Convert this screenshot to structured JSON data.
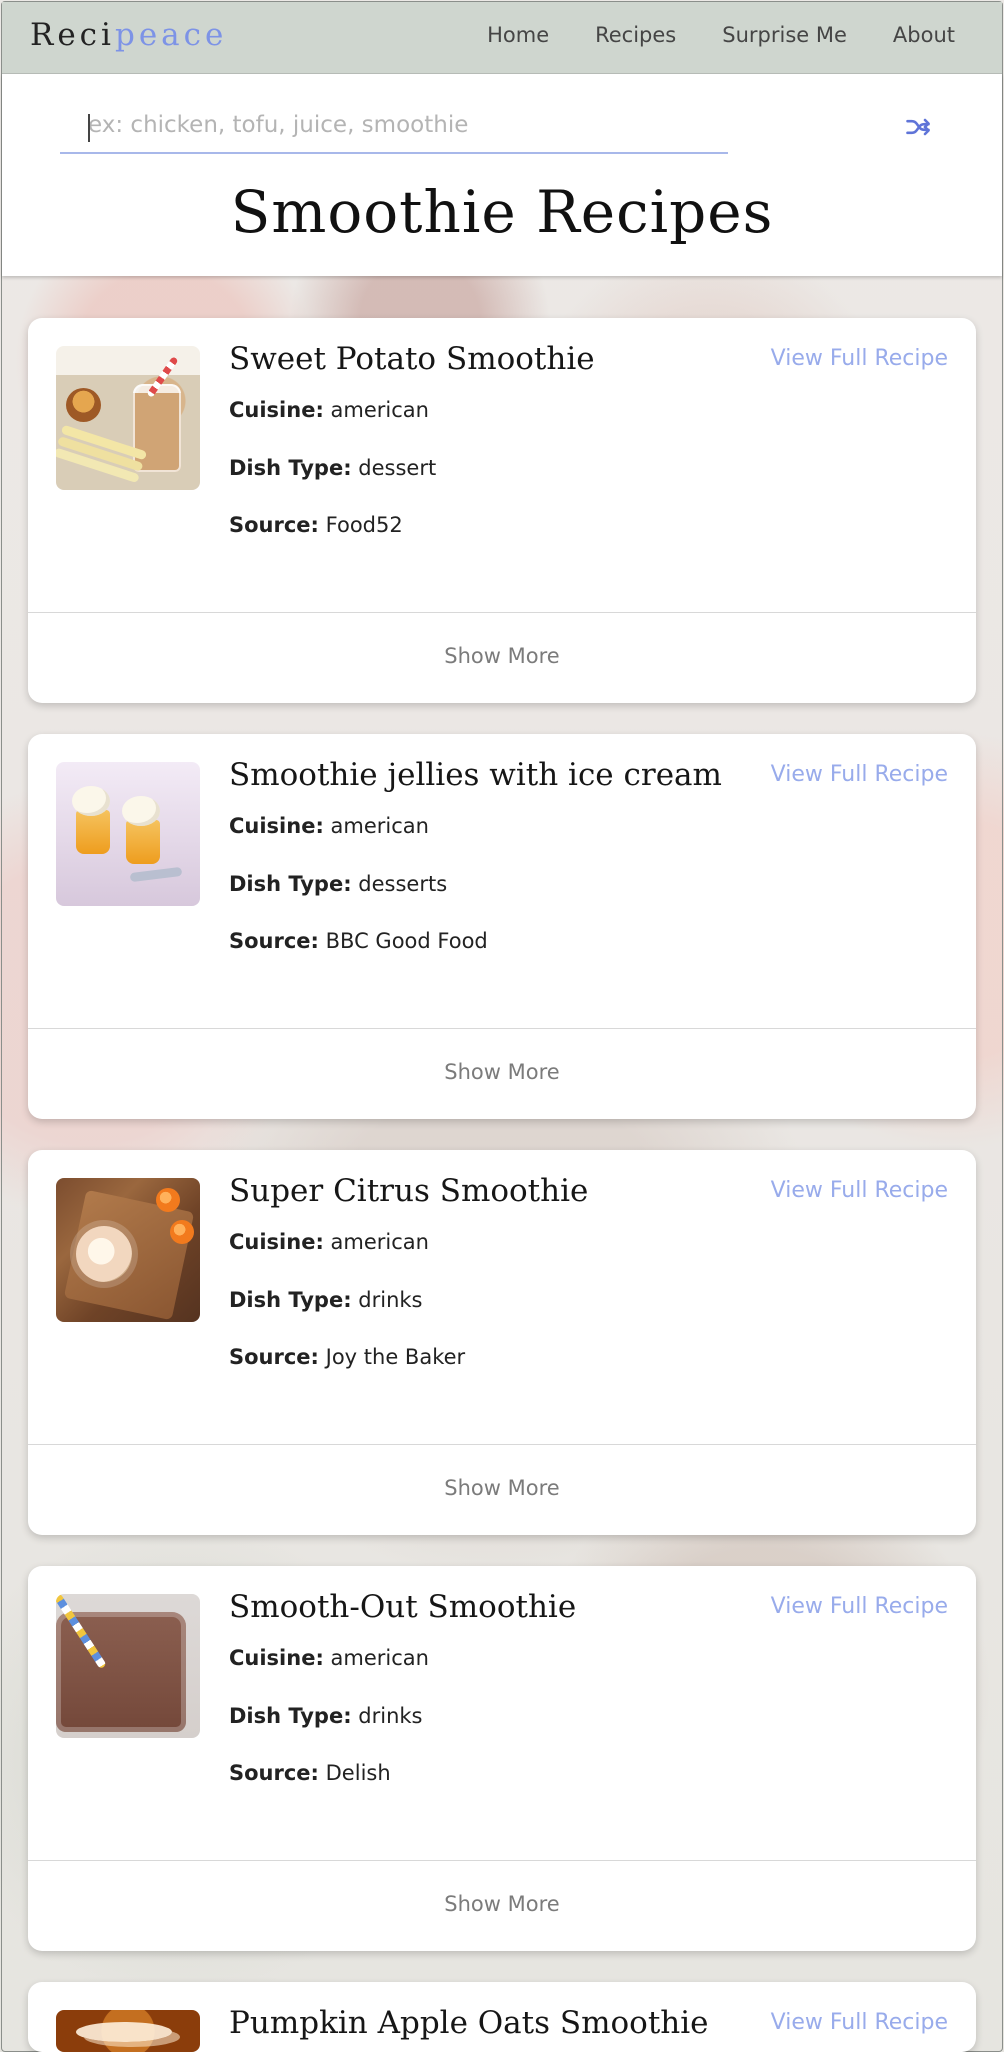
{
  "brand": {
    "name_part1": "Reci",
    "name_part2": "peace"
  },
  "nav": {
    "items": [
      {
        "label": "Home"
      },
      {
        "label": "Recipes"
      },
      {
        "label": "Surprise Me"
      },
      {
        "label": "About"
      }
    ]
  },
  "search": {
    "placeholder": "ex: chicken, tofu, juice, smoothie",
    "value": ""
  },
  "page": {
    "title": "Smoothie Recipes"
  },
  "labels": {
    "cuisine": "Cuisine:",
    "dish_type": "Dish Type:",
    "source": "Source:",
    "view_full_recipe": "View Full Recipe",
    "show_more": "Show More"
  },
  "icons": {
    "shuffle": "shuffle-icon"
  },
  "colors": {
    "accent": "#7d93e6",
    "link": "#98abeb",
    "nav_bg": "#cfd6cf"
  },
  "recipes": [
    {
      "title": "Sweet Potato Smoothie",
      "cuisine": "american",
      "dish_type": "dessert",
      "source": "Food52"
    },
    {
      "title": "Smoothie jellies with ice cream",
      "cuisine": "american",
      "dish_type": "desserts",
      "source": "BBC Good Food"
    },
    {
      "title": "Super Citrus Smoothie",
      "cuisine": "american",
      "dish_type": "drinks",
      "source": "Joy the Baker"
    },
    {
      "title": "Smooth-Out Smoothie",
      "cuisine": "american",
      "dish_type": "drinks",
      "source": "Delish"
    },
    {
      "title": "Pumpkin Apple Oats Smoothie"
    }
  ]
}
